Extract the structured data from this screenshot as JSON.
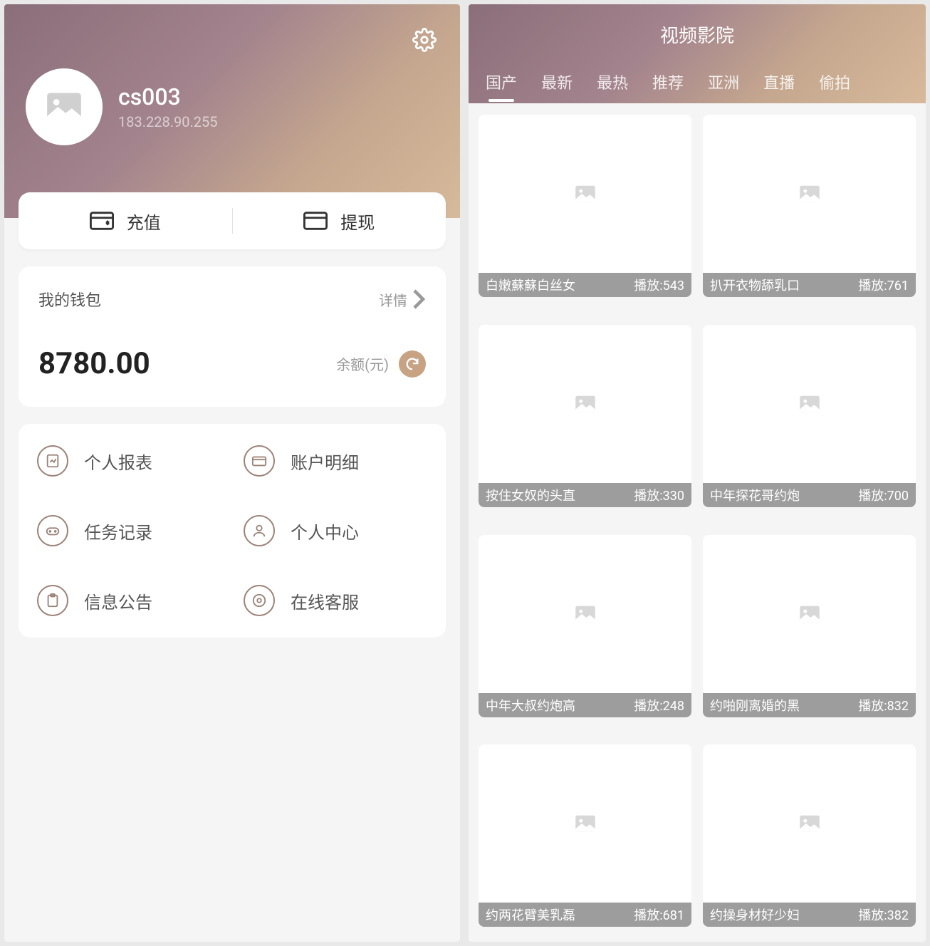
{
  "profile": {
    "username": "cs003",
    "ip": "183.228.90.255"
  },
  "actions": {
    "deposit": "充值",
    "withdraw": "提现"
  },
  "wallet": {
    "title": "我的钱包",
    "moreLabel": "详情",
    "amount": "8780.00",
    "balanceLabel": "余额(元)"
  },
  "menu": {
    "report": "个人报表",
    "account": "账户明细",
    "tasks": "任务记录",
    "center": "个人中心",
    "notice": "信息公告",
    "service": "在线客服"
  },
  "theatre": {
    "title": "视频影院",
    "playPrefix": "播放:",
    "tabs": [
      "国产",
      "最新",
      "最热",
      "推荐",
      "亚洲",
      "直播",
      "偷拍"
    ],
    "activeTab": 0,
    "videos": [
      {
        "title": "白嫩蘇蘇白丝女",
        "plays": "543"
      },
      {
        "title": "扒开衣物舔乳口",
        "plays": "761"
      },
      {
        "title": "按住女奴的头直",
        "plays": "330"
      },
      {
        "title": "中年探花哥约炮",
        "plays": "700"
      },
      {
        "title": "中年大叔约炮高",
        "plays": "248"
      },
      {
        "title": "约啪刚离婚的黑",
        "plays": "832"
      },
      {
        "title": "约两花臂美乳磊",
        "plays": "681"
      },
      {
        "title": "约操身材好少妇",
        "plays": "382"
      }
    ]
  }
}
